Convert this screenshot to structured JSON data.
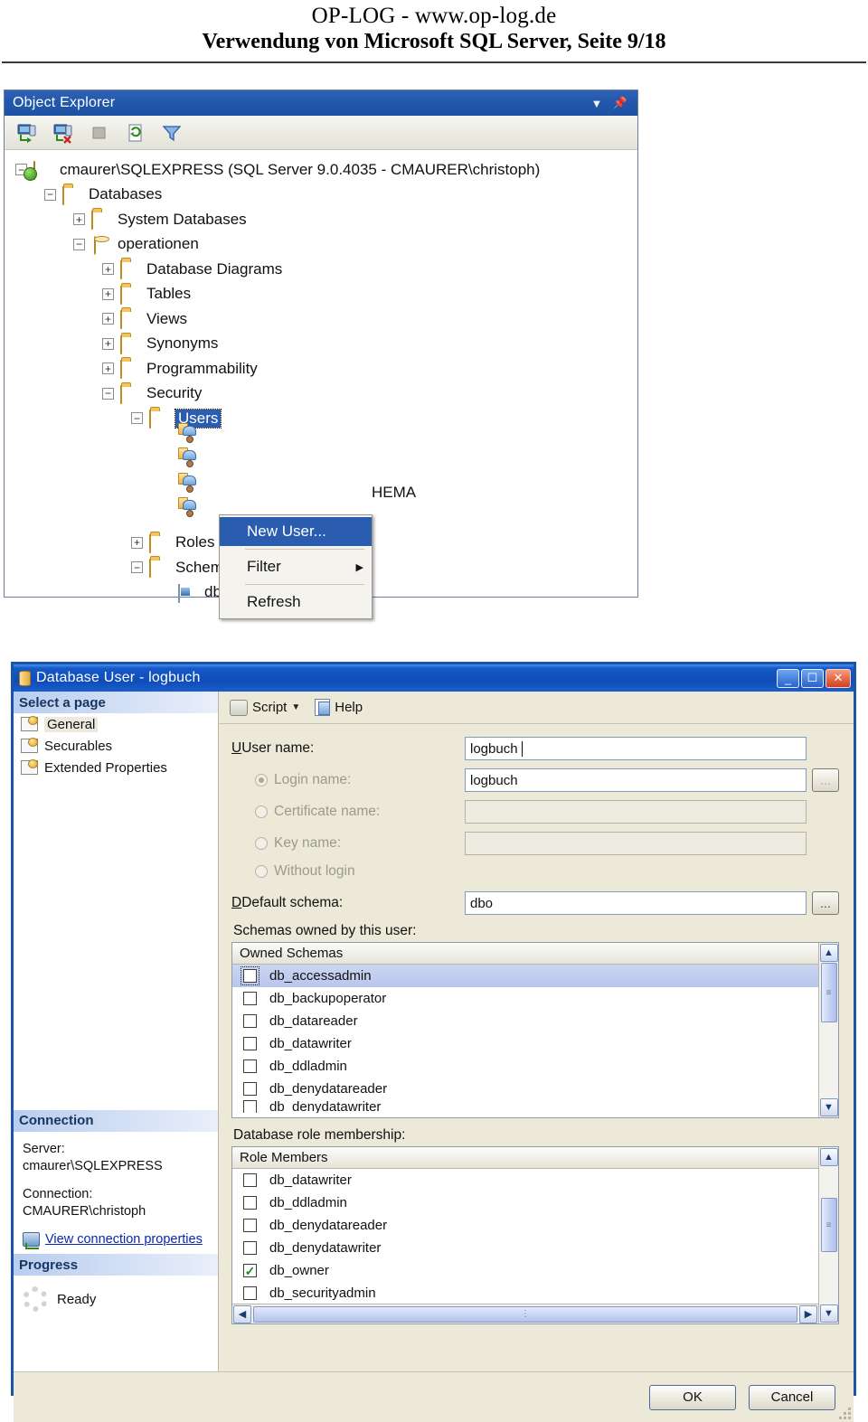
{
  "page": {
    "header_line1": "OP-LOG - www.op-log.de",
    "header_line2": "Verwendung von Microsoft SQL Server, Seite 9/18"
  },
  "object_explorer": {
    "title": "Object Explorer",
    "dropdown_icon": "chevron-down-icon",
    "pin_icon": "pin-icon",
    "toolbar": [
      {
        "name": "connect-icon",
        "label": "Connect"
      },
      {
        "name": "disconnect-icon",
        "label": "Disconnect"
      },
      {
        "name": "stop-icon",
        "label": "Stop"
      },
      {
        "name": "refresh-icon",
        "label": "Refresh"
      },
      {
        "name": "filter-icon",
        "label": "Filter"
      }
    ],
    "tree": [
      {
        "label": "cmaurer\\SQLEXPRESS (SQL Server 9.0.4035 - CMAURER\\christoph)",
        "depth": 0,
        "expander": "minus",
        "icon": "server-icon"
      },
      {
        "label": "Databases",
        "depth": 1,
        "expander": "minus",
        "icon": "folder-icon"
      },
      {
        "label": "System Databases",
        "depth": 2,
        "expander": "plus",
        "icon": "folder-icon"
      },
      {
        "label": "operationen",
        "depth": 2,
        "expander": "minus",
        "icon": "database-icon"
      },
      {
        "label": "Database Diagrams",
        "depth": 3,
        "expander": "plus",
        "icon": "folder-icon"
      },
      {
        "label": "Tables",
        "depth": 3,
        "expander": "plus",
        "icon": "folder-icon"
      },
      {
        "label": "Views",
        "depth": 3,
        "expander": "plus",
        "icon": "folder-icon"
      },
      {
        "label": "Synonyms",
        "depth": 3,
        "expander": "plus",
        "icon": "folder-icon"
      },
      {
        "label": "Programmability",
        "depth": 3,
        "expander": "plus",
        "icon": "folder-icon"
      },
      {
        "label": "Security",
        "depth": 3,
        "expander": "minus",
        "icon": "folder-icon"
      },
      {
        "label": "Users",
        "depth": 4,
        "expander": "minus",
        "icon": "folder-icon",
        "selected": true
      },
      {
        "label": "",
        "depth": 5,
        "expander": "none",
        "icon": "user-icon"
      },
      {
        "label": "",
        "depth": 5,
        "expander": "none",
        "icon": "user-icon"
      },
      {
        "label": "HEMA",
        "depth": 5,
        "expander": "none",
        "icon": "user-icon"
      },
      {
        "label": "",
        "depth": 5,
        "expander": "none",
        "icon": "user-icon"
      },
      {
        "label": "Roles",
        "depth": 4,
        "expander": "plus",
        "icon": "folder-icon"
      },
      {
        "label": "Schemas",
        "depth": 4,
        "expander": "minus",
        "icon": "folder-icon"
      },
      {
        "label": "db_accessadmin",
        "depth": 5,
        "expander": "none",
        "icon": "schema-icon"
      }
    ]
  },
  "context_menu": {
    "items": [
      {
        "label": "New User...",
        "highlighted": true,
        "submenu": false
      },
      {
        "separator": true
      },
      {
        "label": "Filter",
        "highlighted": false,
        "submenu": true
      },
      {
        "separator": true
      },
      {
        "label": "Refresh",
        "highlighted": false,
        "submenu": false
      }
    ]
  },
  "dialog": {
    "title": "Database User - logbuch",
    "title_icon": "database-user-icon",
    "window_buttons": {
      "minimize": "_",
      "maximize": "☐",
      "close": "✕"
    },
    "select_page": {
      "header": "Select a page",
      "items": [
        {
          "label": "General",
          "selected": true
        },
        {
          "label": "Securables",
          "selected": false
        },
        {
          "label": "Extended Properties",
          "selected": false
        }
      ]
    },
    "connection": {
      "header": "Connection",
      "server_label": "Server:",
      "server_value": "cmaurer\\SQLEXPRESS",
      "connection_label": "Connection:",
      "connection_value": "CMAURER\\christoph",
      "link": "View connection properties"
    },
    "progress": {
      "header": "Progress",
      "status": "Ready"
    },
    "toolbar": {
      "script_label": "Script",
      "help_label": "Help"
    },
    "form": {
      "user_name_label": "User name:",
      "user_name_value": "logbuch",
      "login_name_label": "Login name:",
      "login_name_value": "logbuch",
      "certificate_name_label": "Certificate name:",
      "certificate_name_value": "",
      "key_name_label": "Key name:",
      "key_name_value": "",
      "without_login_label": "Without login",
      "default_schema_label": "Default schema:",
      "default_schema_value": "dbo",
      "ellipsis_label": "..."
    },
    "owned_schemas": {
      "section_label": "Schemas owned by this user:",
      "column_header": "Owned Schemas",
      "rows": [
        {
          "label": "db_accessadmin",
          "checked": false,
          "selected": true
        },
        {
          "label": "db_backupoperator",
          "checked": false,
          "selected": false
        },
        {
          "label": "db_datareader",
          "checked": false,
          "selected": false
        },
        {
          "label": "db_datawriter",
          "checked": false,
          "selected": false
        },
        {
          "label": "db_ddladmin",
          "checked": false,
          "selected": false
        },
        {
          "label": "db_denydatareader",
          "checked": false,
          "selected": false
        },
        {
          "label": "db_denydatawriter",
          "checked": false,
          "selected": false
        }
      ]
    },
    "role_membership": {
      "section_label": "Database role membership:",
      "column_header": "Role Members",
      "rows": [
        {
          "label": "db_datawriter",
          "checked": false
        },
        {
          "label": "db_ddladmin",
          "checked": false
        },
        {
          "label": "db_denydatareader",
          "checked": false
        },
        {
          "label": "db_denydatawriter",
          "checked": false
        },
        {
          "label": "db_owner",
          "checked": true
        },
        {
          "label": "db_securityadmin",
          "checked": false
        }
      ]
    },
    "footer": {
      "ok_label": "OK",
      "cancel_label": "Cancel"
    }
  }
}
